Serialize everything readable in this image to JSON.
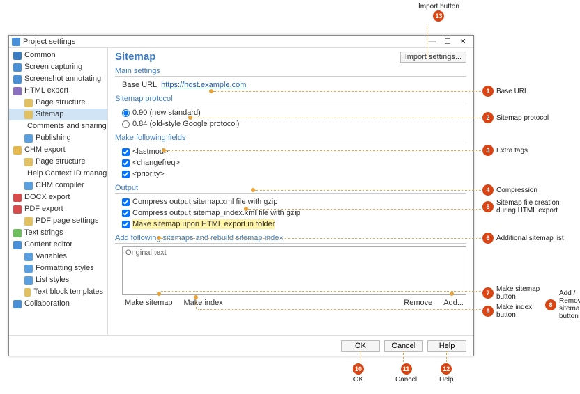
{
  "window": {
    "title": "Project settings"
  },
  "tree": {
    "items": [
      {
        "label": "Common",
        "lvl": 0,
        "c": "#3b7bbf"
      },
      {
        "label": "Screen capturing",
        "lvl": 0,
        "c": "#4a90d9"
      },
      {
        "label": "Screenshot annotating",
        "lvl": 0,
        "c": "#4a90d9"
      },
      {
        "label": "HTML export",
        "lvl": 0,
        "c": "#8a6fc1"
      },
      {
        "label": "Page structure",
        "lvl": 1,
        "c": "#e0c060"
      },
      {
        "label": "Sitemap",
        "lvl": 1,
        "c": "#e0c060",
        "sel": true
      },
      {
        "label": "Comments and sharing",
        "lvl": 1,
        "c": "#5aa0e0"
      },
      {
        "label": "Publishing",
        "lvl": 1,
        "c": "#5aa0e0"
      },
      {
        "label": "CHM export",
        "lvl": 0,
        "c": "#e6b84e"
      },
      {
        "label": "Page structure",
        "lvl": 1,
        "c": "#e0c060"
      },
      {
        "label": "Help Context ID management",
        "lvl": 1,
        "c": "#e0c060"
      },
      {
        "label": "CHM compiler",
        "lvl": 1,
        "c": "#5aa0e0"
      },
      {
        "label": "DOCX export",
        "lvl": 0,
        "c": "#d94c4c"
      },
      {
        "label": "PDF export",
        "lvl": 0,
        "c": "#d94c4c"
      },
      {
        "label": "PDF page settings",
        "lvl": 1,
        "c": "#e0c060"
      },
      {
        "label": "Text strings",
        "lvl": 0,
        "c": "#6cbf5a"
      },
      {
        "label": "Content editor",
        "lvl": 0,
        "c": "#4a90d9"
      },
      {
        "label": "Variables",
        "lvl": 1,
        "c": "#5aa0e0"
      },
      {
        "label": "Formatting styles",
        "lvl": 1,
        "c": "#5aa0e0"
      },
      {
        "label": "List styles",
        "lvl": 1,
        "c": "#5aa0e0"
      },
      {
        "label": "Text block templates",
        "lvl": 1,
        "c": "#e0c060"
      },
      {
        "label": "Collaboration",
        "lvl": 0,
        "c": "#4a90d9"
      }
    ]
  },
  "page": {
    "title": "Sitemap",
    "import": "Import settings...",
    "sec_main": "Main settings",
    "base_url_label": "Base URL",
    "base_url_value": "https://host.example.com",
    "sec_proto": "Sitemap protocol",
    "proto1": "0.90 (new standard)",
    "proto2": "0.84 (old-style Google protocol)",
    "sec_fields": "Make following fields",
    "f1": "<lastmod>",
    "f2": "<changefreq>",
    "f3": "<priority>",
    "sec_output": "Output",
    "o1": "Compress output sitemap.xml file with gzip",
    "o2": "Compress output sitemap_index.xml file with gzip",
    "o3": "Make sitemap upon HTML export in folder",
    "sec_add": "Add following sitemaps and rebuild sitemap index",
    "list_placeholder": "Original text",
    "btn_make_sitemap": "Make sitemap",
    "btn_make_index": "Make index",
    "btn_remove": "Remove",
    "btn_add": "Add...",
    "btn_ok": "OK",
    "btn_cancel": "Cancel",
    "btn_help": "Help"
  },
  "callouts": {
    "c1": "Base URL",
    "c2": "Sitemap protocol",
    "c3": "Extra tags",
    "c4": "Compression",
    "c5": "Sitemap file creation during HTML export",
    "c6": "Additional sitemap list",
    "c7": "Make sitemap button",
    "c8": "Add / Remove sitemap button",
    "c9": "Make index button",
    "c10": "OK",
    "c11": "Cancel",
    "c12": "Help",
    "c13": "Import button"
  }
}
